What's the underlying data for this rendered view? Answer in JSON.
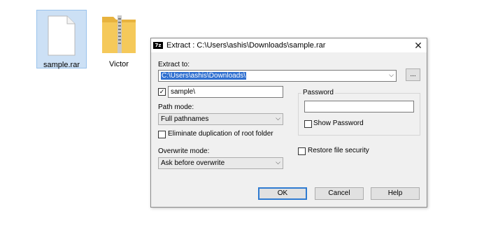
{
  "desktop": {
    "icons": [
      {
        "label": "sample.rar",
        "icon": "file-icon"
      },
      {
        "label": "Victor",
        "icon": "zip-folder-icon"
      }
    ]
  },
  "dialog": {
    "title": "Extract : C:\\Users\\ashis\\Downloads\\sample.rar",
    "title_icon": "7z",
    "close_glyph": "✕",
    "extract_to_label": "Extract to:",
    "extract_to_value": "C:\\Users\\ashis\\Downloads\\",
    "browse_label": "...",
    "subfolder_checked": true,
    "subfolder_value": "sample\\",
    "path_mode_label": "Path mode:",
    "path_mode_value": "Full pathnames",
    "eliminate_dup_label": "Eliminate duplication of root folder",
    "eliminate_dup_checked": false,
    "overwrite_mode_label": "Overwrite mode:",
    "overwrite_mode_value": "Ask before overwrite",
    "password_group_label": "Password",
    "password_value": "",
    "show_password_label": "Show Password",
    "show_password_checked": false,
    "restore_security_label": "Restore file security",
    "restore_security_checked": false,
    "ok_label": "OK",
    "cancel_label": "Cancel",
    "help_label": "Help"
  },
  "colors": {
    "selection": "#3070d0",
    "accent_border": "#2f7bd1",
    "folder": "#f5c95a"
  }
}
